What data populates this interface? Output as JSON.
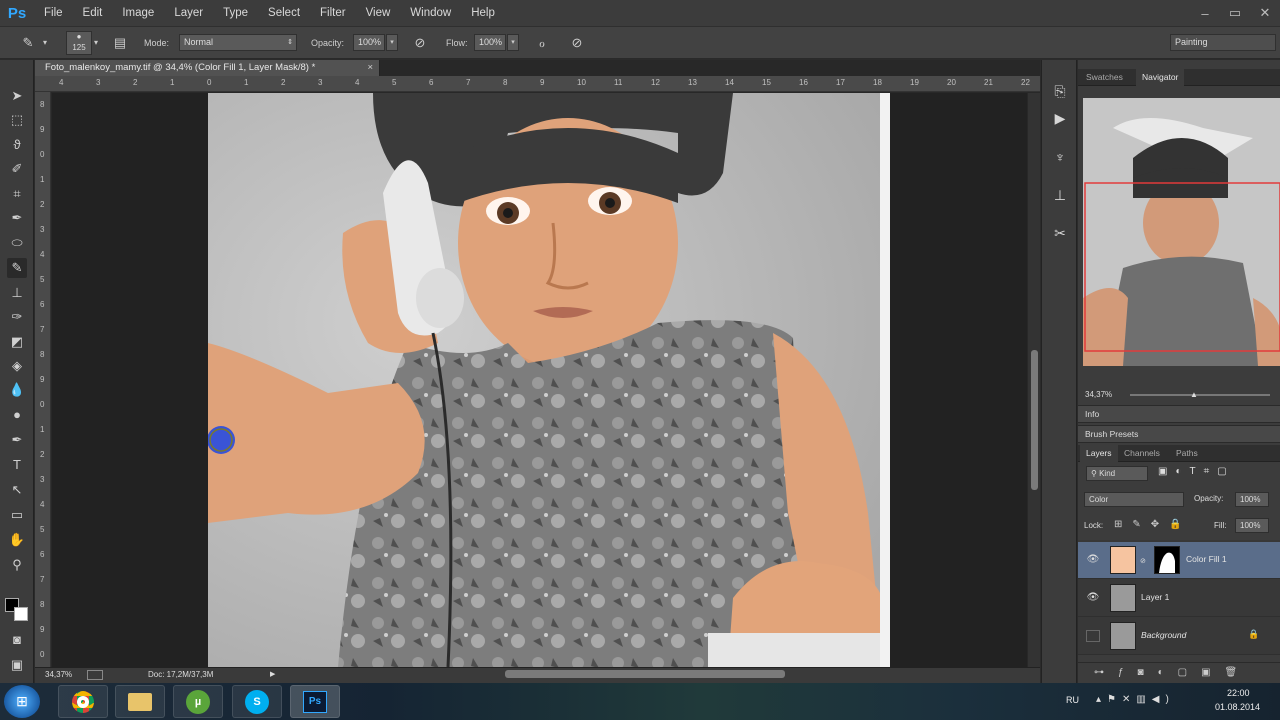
{
  "app": {
    "logo": "Ps"
  },
  "menu": [
    "File",
    "Edit",
    "Image",
    "Layer",
    "Type",
    "Select",
    "Filter",
    "View",
    "Window",
    "Help"
  ],
  "window_controls": {
    "minimize": "–",
    "restore": "▭",
    "close": "✕"
  },
  "options_bar": {
    "brush_size": "125",
    "mode_label": "Mode:",
    "mode_value": "Normal",
    "opacity_label": "Opacity:",
    "opacity_value": "100%",
    "flow_label": "Flow:",
    "flow_value": "100%",
    "workspace": "Painting"
  },
  "document": {
    "tab_title": "Foto_malenkoy_mamy.tif @ 34,4% (Color Fill 1, Layer Mask/8) *",
    "tab_close": "×",
    "ruler_top": [
      "4",
      "3",
      "2",
      "1",
      "0",
      "1",
      "2",
      "3",
      "4",
      "5",
      "6",
      "7",
      "8",
      "9",
      "10",
      "11",
      "12",
      "13",
      "14",
      "15",
      "16",
      "17",
      "18",
      "19",
      "20",
      "21",
      "22"
    ],
    "ruler_left": [
      "8",
      "9",
      "0",
      "1",
      "2",
      "3",
      "4",
      "5",
      "6",
      "7",
      "8",
      "9",
      "0",
      "1",
      "2",
      "3",
      "4",
      "5",
      "6",
      "7",
      "8",
      "9",
      "0"
    ],
    "zoom": "34,37%",
    "doc_size": "Doc: 17,2M/37,3M"
  },
  "panels": {
    "tabs_top": [
      "Swatches",
      "Navigator"
    ],
    "navigator_zoom": "34,37%",
    "info": "Info",
    "brush_presets": "Brush Presets",
    "layer_tabs": [
      "Layers",
      "Channels",
      "Paths"
    ],
    "filter_kind": "Kind",
    "blend_mode": "Color",
    "opacity_label": "Opacity:",
    "opacity_value": "100%",
    "lock_label": "Lock:",
    "fill_label": "Fill:",
    "fill_value": "100%",
    "layers": [
      {
        "name": "Color Fill 1",
        "visible": true,
        "selected": true
      },
      {
        "name": "Layer 1",
        "visible": true,
        "selected": false
      },
      {
        "name": "Background",
        "visible": false,
        "selected": false
      }
    ]
  },
  "taskbar": {
    "lang": "RU",
    "time": "22:00",
    "date": "01.08.2014"
  },
  "colors": {
    "fill_color": "#f6c4a0",
    "skin_tint": "#d99a72",
    "accent_blue": "#31a8ff"
  }
}
